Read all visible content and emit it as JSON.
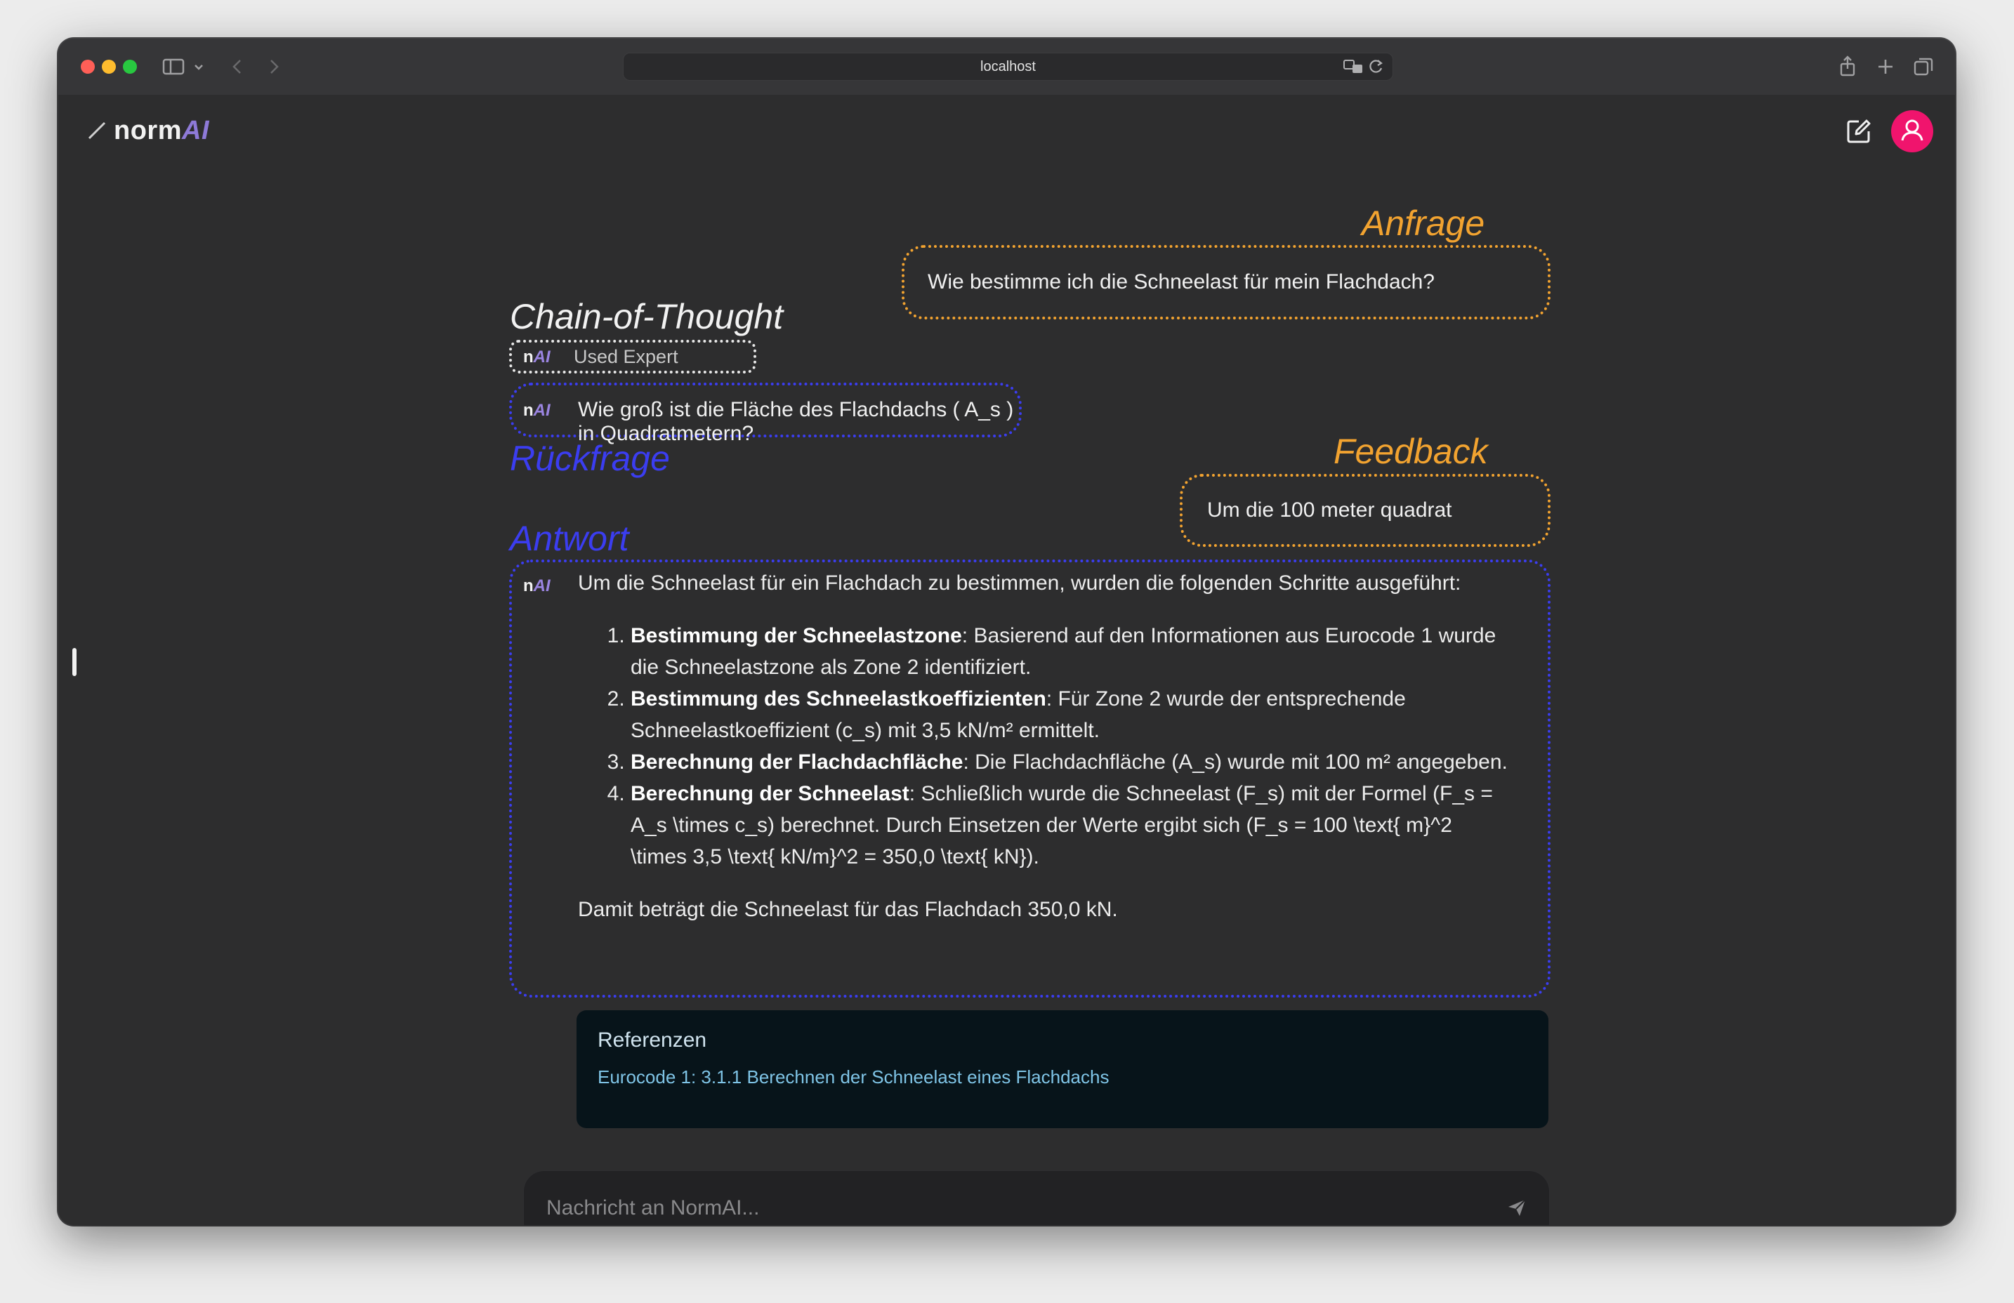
{
  "browser": {
    "url": "localhost",
    "traffic_colors": [
      "#ff5f57",
      "#febc2e",
      "#28c840"
    ]
  },
  "app": {
    "logo_text": "norm",
    "logo_ai": "AI"
  },
  "annotations": {
    "anfrage": "Anfrage",
    "chain_of_thought": "Chain-of-Thought",
    "rueckfrage": "Rückfrage",
    "feedback": "Feedback",
    "antwort": "Antwort"
  },
  "badge": {
    "n": "n",
    "ai": "AI"
  },
  "messages": {
    "user_query": "Wie bestimme ich die Schneelast für mein Flachdach?",
    "used_expert": "Used Expert",
    "followup_question": "Wie groß ist die Fläche des Flachdachs ( A_s ) in Quadratmetern?",
    "user_feedback": "Um die 100 meter quadrat"
  },
  "answer": {
    "intro": "Um die Schneelast für ein Flachdach zu bestimmen, wurden die folgenden Schritte ausgeführt:",
    "steps": [
      {
        "title": "Bestimmung der Schneelastzone",
        "text": ": Basierend auf den Informationen aus Eurocode 1 wurde die Schneelastzone als Zone 2 identifiziert."
      },
      {
        "title": "Bestimmung des Schneelastkoeffizienten",
        "text": ": Für Zone 2 wurde der entsprechende Schneelastkoeffizient (c_s) mit 3,5 kN/m² ermittelt."
      },
      {
        "title": "Berechnung der Flachdachfläche",
        "text": ": Die Flachdachfläche (A_s) wurde mit 100 m² angegeben."
      },
      {
        "title": "Berechnung der Schneelast",
        "text": ": Schließlich wurde die Schneelast (F_s) mit der Formel (F_s = A_s \\times c_s) berechnet. Durch Einsetzen der Werte ergibt sich (F_s = 100 \\text{ m}^2 \\times 3,5 \\text{ kN/m}^2 = 350,0 \\text{ kN})."
      }
    ],
    "conclusion": "Damit beträgt die Schneelast für das Flachdach 350,0 kN."
  },
  "references": {
    "title": "Referenzen",
    "link": "Eurocode 1: 3.1.1 Berechnen der Schneelast eines Flachdachs"
  },
  "composer": {
    "placeholder": "Nachricht an NormAI..."
  }
}
